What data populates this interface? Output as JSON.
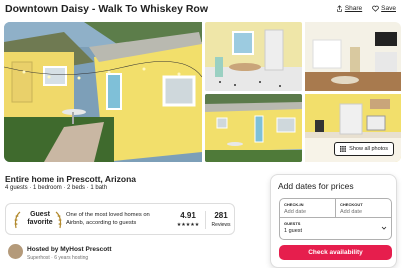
{
  "listing": {
    "title": "Downtown Daisy - Walk To Whiskey Row",
    "share_label": "Share",
    "save_label": "Save"
  },
  "gallery": {
    "show_all_label": "Show all photos"
  },
  "summary": {
    "subtitle": "Entire home in Prescott, Arizona",
    "details": "4 guests · 1 bedroom · 2 beds · 1 bath"
  },
  "guest_favorite": {
    "label_line1": "Guest",
    "label_line2": "favorite",
    "description": "One of the most loved homes on Airbnb, according to guests",
    "rating": "4.91",
    "stars": "★★★★★",
    "reviews_count": "281",
    "reviews_label": "Reviews"
  },
  "host": {
    "name": "Hosted by MyHost Prescott",
    "meta": "Superhost · 6 years hosting"
  },
  "booking": {
    "heading": "Add dates for prices",
    "checkin_label": "CHECK-IN",
    "checkin_value": "Add date",
    "checkout_label": "CHECKOUT",
    "checkout_value": "Add date",
    "guests_label": "GUESTS",
    "guests_value": "1 guest",
    "cta_label": "Check availability"
  },
  "colors": {
    "accent": "#e61e4d",
    "house_yellow": "#f2df6b"
  }
}
